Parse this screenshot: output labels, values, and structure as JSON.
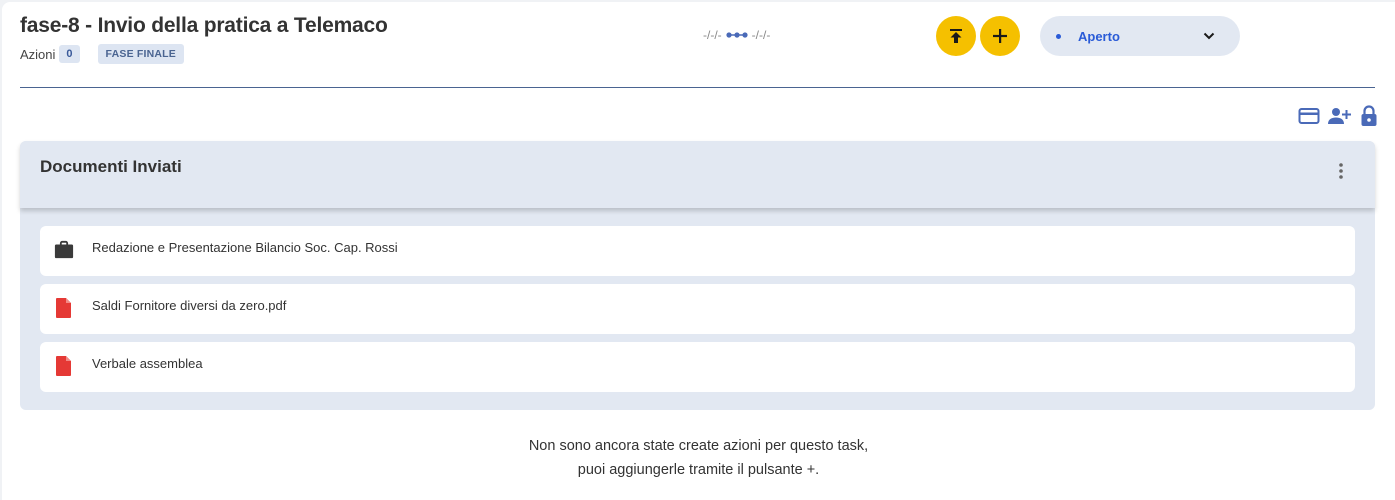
{
  "header": {
    "title": "fase-8 - Invio della pratica a Telemaco",
    "actions_label": "Azioni",
    "actions_count": "0",
    "phase_badge": "FASE FINALE",
    "start_date": "-/-/-",
    "end_date": "-/-/-"
  },
  "status": {
    "label": "Aperto",
    "color": "#2a5bd7"
  },
  "colors": {
    "accent_yellow": "#f5c000",
    "panel_bg": "#e2e8f2",
    "pdf_red": "#e53935",
    "icon_blue": "#4a6ab8"
  },
  "documents_panel": {
    "title": "Documenti Inviati",
    "items": [
      {
        "name": "Redazione e Presentazione Bilancio Soc. Cap. Rossi",
        "icon": "briefcase-icon"
      },
      {
        "name": "Saldi Fornitore diversi da zero.pdf",
        "icon": "pdf-file-icon"
      },
      {
        "name": "Verbale assemblea",
        "icon": "pdf-file-icon"
      }
    ]
  },
  "empty_state": {
    "line1": "Non sono ancora state create azioni per questo task,",
    "line2": "puoi aggiungerle tramite il pulsante +."
  }
}
